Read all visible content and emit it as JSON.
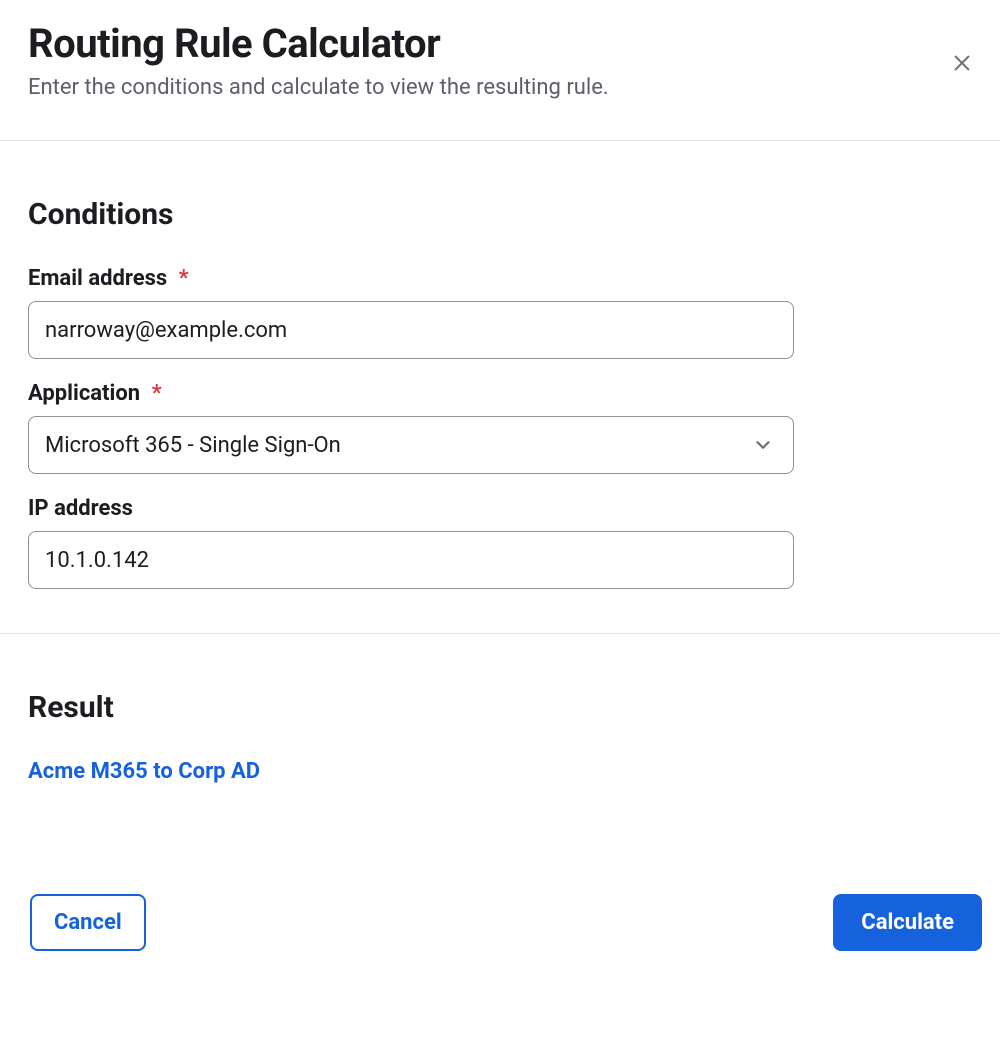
{
  "header": {
    "title": "Routing Rule Calculator",
    "subtitle": "Enter the conditions and calculate to view the resulting rule."
  },
  "conditions": {
    "section_title": "Conditions",
    "email": {
      "label": "Email address",
      "required_mark": "*",
      "value": "narroway@example.com"
    },
    "application": {
      "label": "Application",
      "required_mark": "*",
      "value": "Microsoft 365 - Single Sign-On"
    },
    "ip": {
      "label": "IP address",
      "value": "10.1.0.142"
    }
  },
  "result": {
    "section_title": "Result",
    "rule_name": "Acme M365 to Corp AD"
  },
  "footer": {
    "cancel_label": "Cancel",
    "calculate_label": "Calculate"
  }
}
